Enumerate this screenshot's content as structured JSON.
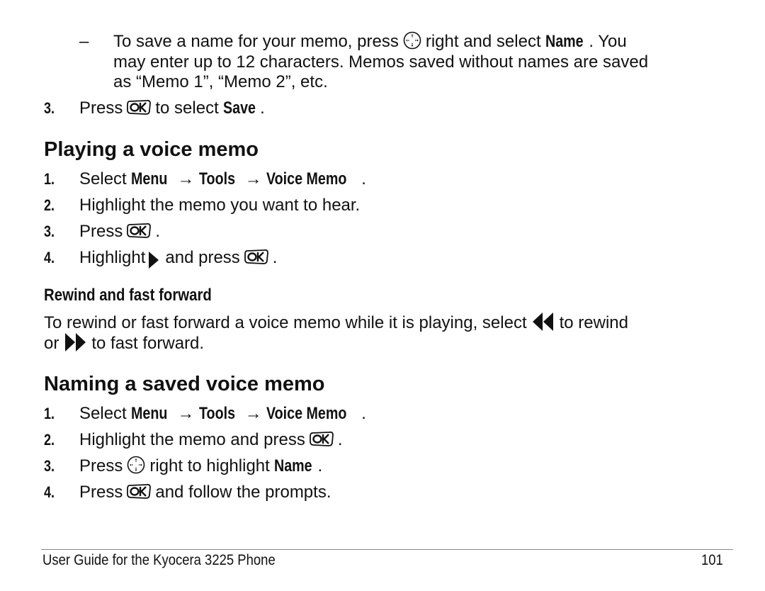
{
  "top_bullet": {
    "dash": "–",
    "line1_pre": "To save a name for your memo, press",
    "line1_post": "right and select",
    "line1_bold": "Name",
    "line1_end": ". You",
    "line2": "may enter up to 12 characters. Memos saved without names are saved",
    "line3": "as “Memo 1”, “Memo 2”, etc."
  },
  "step3_save": {
    "num": "3.",
    "pre": "Press",
    "post": "to select",
    "bold": "Save",
    "end": "."
  },
  "section_playing": {
    "title": "Playing a voice memo",
    "steps": [
      {
        "num": "1.",
        "pre": "Select",
        "menu": "Menu",
        "arrow": "→",
        "tools": "Tools",
        "voice": "Voice Memo",
        "end": "."
      },
      {
        "num": "2.",
        "text": "Highlight the memo you want to hear."
      },
      {
        "num": "3.",
        "pre": "Press",
        "end": "."
      },
      {
        "num": "4.",
        "pre": "Highlight",
        "mid": "and press",
        "end": "."
      }
    ]
  },
  "subsection_rewind": {
    "title": "Rewind and fast forward",
    "line1_pre": "To rewind or fast forward a voice memo while it is playing, select",
    "line1_post": "to rewind",
    "line2_pre": "or",
    "line2_post": "to fast forward."
  },
  "section_naming": {
    "title": "Naming a saved voice memo",
    "steps": [
      {
        "num": "1.",
        "pre": "Select",
        "menu": "Menu",
        "arrow": "→",
        "tools": "Tools",
        "voice": "Voice Memo",
        "end": "."
      },
      {
        "num": "2.",
        "pre": "Highlight the memo and press",
        "end": "."
      },
      {
        "num": "3.",
        "pre": "Press",
        "post": "right to highlight",
        "bold": "Name",
        "end": "."
      },
      {
        "num": "4.",
        "pre": "Press",
        "post": "and follow the prompts."
      }
    ]
  },
  "footer": {
    "title": "User Guide for the Kyocera 3225 Phone",
    "page": "101"
  },
  "icons": {
    "ok": "ok-key-icon",
    "nav": "navigation-key-icon",
    "play": "play-icon",
    "rewind": "rewind-icon",
    "fastforward": "fast-forward-icon"
  }
}
